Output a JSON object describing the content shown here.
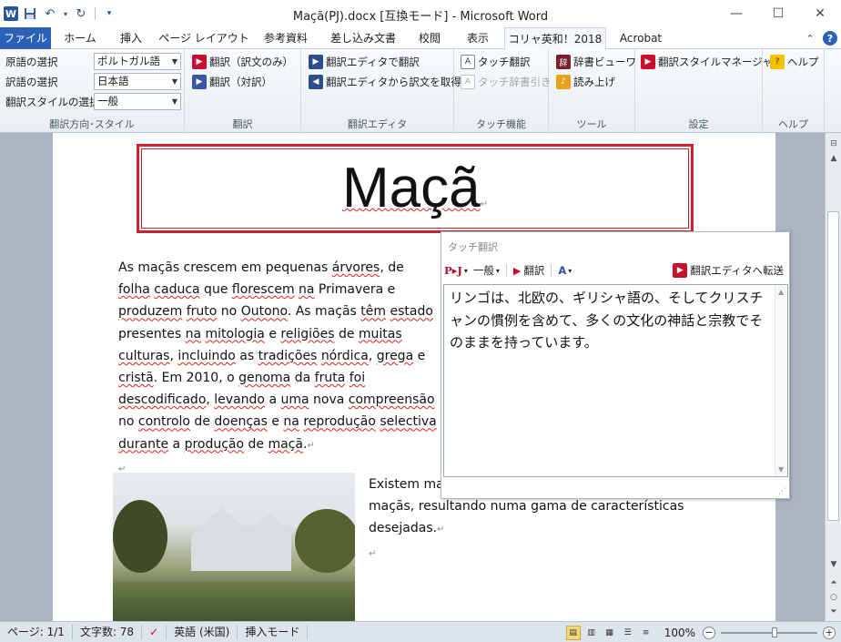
{
  "window": {
    "title": "Maçã(PJ).docx [互換モード] - Microsoft Word",
    "app_icon_letter": "W"
  },
  "tabs": {
    "file": "ファイル",
    "home": "ホーム",
    "insert": "挿入",
    "page_layout": "ページ レイアウト",
    "references": "参考資料",
    "mailings": "差し込み文書",
    "review": "校閲",
    "view": "表示",
    "korya": "コリャ英和！2018",
    "acrobat": "Acrobat"
  },
  "ribbon": {
    "direction": {
      "src_label": "原語の選択",
      "src_value": "ポルトガル語",
      "dst_label": "訳語の選択",
      "dst_value": "日本語",
      "style_label": "翻訳スタイルの選択",
      "style_value": "一般",
      "group_label": "翻訳方向･スタイル"
    },
    "translate": {
      "only": "翻訳（訳文のみ）",
      "pair": "翻訳（対訳）",
      "group_label": "翻訳"
    },
    "editor": {
      "open": "翻訳エディタで翻訳",
      "get": "翻訳エディタから訳文を取得",
      "group_label": "翻訳エディタ"
    },
    "touch": {
      "touch_translate": "タッチ翻訳",
      "touch_dict": "タッチ辞書引き",
      "group_label": "タッチ機能"
    },
    "tools": {
      "dict_viewer": "辞書ビューワ",
      "read_aloud": "読み上げ",
      "group_label": "ツール"
    },
    "settings": {
      "style_manager": "翻訳スタイルマネージャ",
      "group_label": "設定"
    },
    "help": {
      "help": "ヘルプ",
      "group_label": "ヘルプ"
    }
  },
  "document": {
    "title": "Maçã",
    "para1": [
      {
        "t": "As maçãs crescem em pequenas "
      },
      {
        "t": "árvores",
        "sq": true
      },
      {
        "t": ", de "
      },
      {
        "t": "folha",
        "sq": true
      },
      {
        "t": " "
      },
      {
        "t": "caduca",
        "sq": true
      },
      {
        "t": " que "
      },
      {
        "t": "florescem",
        "sq": true
      },
      {
        "t": " "
      },
      {
        "t": "na",
        "sq": true
      },
      {
        "t": " Primavera e "
      },
      {
        "t": "produzem",
        "sq": true
      },
      {
        "t": " "
      },
      {
        "t": "fruto",
        "sq": true
      },
      {
        "t": " no "
      },
      {
        "t": "Outono",
        "sq": true
      },
      {
        "t": ". As maçãs "
      },
      {
        "t": "têm",
        "sq": true
      },
      {
        "t": " "
      },
      {
        "t": "estado",
        "sq": true
      },
      {
        "t": " presentes "
      },
      {
        "t": "na",
        "sq": true
      },
      {
        "t": " "
      },
      {
        "t": "mitologia",
        "sq": true
      },
      {
        "t": " e "
      },
      {
        "t": "religiões",
        "sq": true
      },
      {
        "t": " de "
      },
      {
        "t": "muitas",
        "sq": true
      },
      {
        "t": " "
      },
      {
        "t": "culturas",
        "sq": true
      },
      {
        "t": ", "
      },
      {
        "t": "incluindo",
        "sq": true
      },
      {
        "t": " as "
      },
      {
        "t": "tradições",
        "sq": true
      },
      {
        "t": " "
      },
      {
        "t": "nórdica",
        "sq": true
      },
      {
        "t": ", "
      },
      {
        "t": "grega",
        "sq": true
      },
      {
        "t": " e "
      },
      {
        "t": "cristã",
        "sq": true
      },
      {
        "t": ". Em "
      },
      {
        "t": "2010, o "
      },
      {
        "t": "genoma",
        "sq": true
      },
      {
        "t": " da "
      },
      {
        "t": "fruta",
        "sq": true
      },
      {
        "t": " "
      },
      {
        "t": "foi",
        "sq": true
      },
      {
        "t": " "
      },
      {
        "t": "descodificado",
        "sq": true
      },
      {
        "t": ", "
      },
      {
        "t": "levando",
        "sq": true
      },
      {
        "t": " "
      },
      {
        "t": "a "
      },
      {
        "t": "uma",
        "sq": true
      },
      {
        "t": " nova "
      },
      {
        "t": "compreensão",
        "sq": true
      },
      {
        "t": " no "
      },
      {
        "t": "controlo",
        "sq": true
      },
      {
        "t": " de "
      },
      {
        "t": "doenças",
        "sq": true
      },
      {
        "t": " e "
      },
      {
        "t": "na",
        "sq": true
      },
      {
        "t": " "
      },
      {
        "t": "reprodução",
        "sq": true
      },
      {
        "t": " "
      },
      {
        "t": "selectiva",
        "sq": true
      },
      {
        "t": " "
      },
      {
        "t": "durante",
        "sq": true
      },
      {
        "t": " a "
      },
      {
        "t": "produção",
        "sq": true
      },
      {
        "t": " de "
      },
      {
        "t": "maçã",
        "sq": true
      },
      {
        "t": "."
      }
    ],
    "para2_line1": "Existem ma",
    "para2_line2": "maçãs, resultando numa gama de características",
    "para2_line3": "desejadas."
  },
  "touch_panel": {
    "title": "タッチ翻訳",
    "direction": "P▸J",
    "style": "一般",
    "translate_button": "翻訳",
    "send_button": "翻訳エディタへ転送",
    "result": "リンゴは、北欧の、ギリシャ語の、そしてクリスチャンの慣例を含めて、多くの文化の神話と宗教でそのままを持っています。"
  },
  "status": {
    "page": "ページ: 1/1",
    "words": "文字数: 78",
    "language": "英語 (米国)",
    "mode": "挿入モード",
    "zoom": "100%"
  }
}
